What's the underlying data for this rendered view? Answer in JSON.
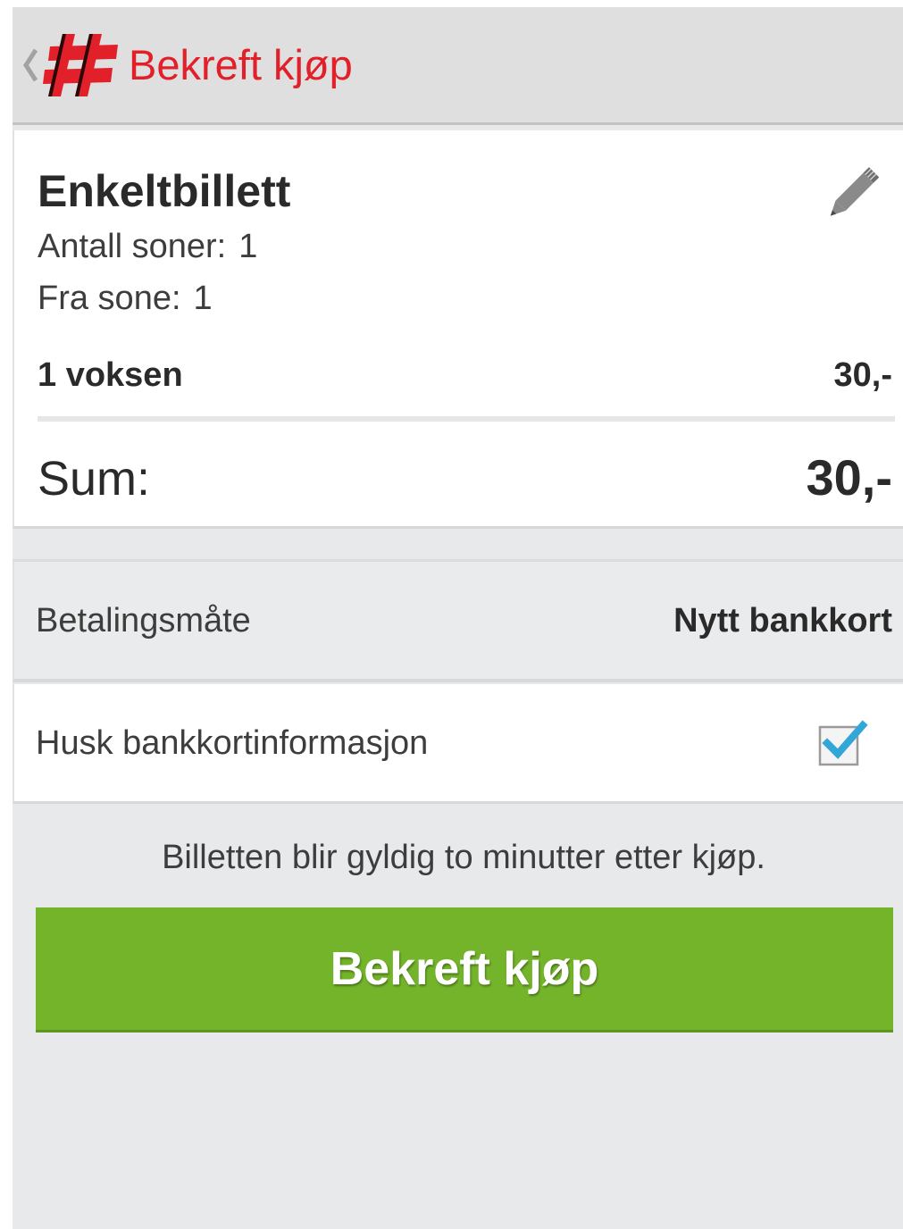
{
  "action_bar": {
    "title": "Bekreft kjøp",
    "logo_icon": "hash-logo-icon",
    "back_icon": "back-caret-icon",
    "accent_color": "#e1202a"
  },
  "ticket": {
    "title": "Enkeltbillett",
    "edit_icon": "pencil-icon",
    "zones": {
      "label": "Antall soner:",
      "value": "1"
    },
    "from_zone": {
      "label": "Fra sone:",
      "value": "1"
    },
    "passengers": [
      {
        "label": "1 voksen",
        "price": "30,-"
      }
    ],
    "sum": {
      "label": "Sum:",
      "value": "30,-"
    }
  },
  "payment": {
    "label": "Betalingsmåte",
    "value": "Nytt bankkort"
  },
  "remember_card": {
    "label": "Husk bankkortinformasjon",
    "checked": true,
    "check_color": "#33a6d8"
  },
  "notice": "Billetten blir gyldig to minutter etter kjøp.",
  "confirm_button": {
    "label": "Bekreft kjøp",
    "color": "#74b42b"
  }
}
